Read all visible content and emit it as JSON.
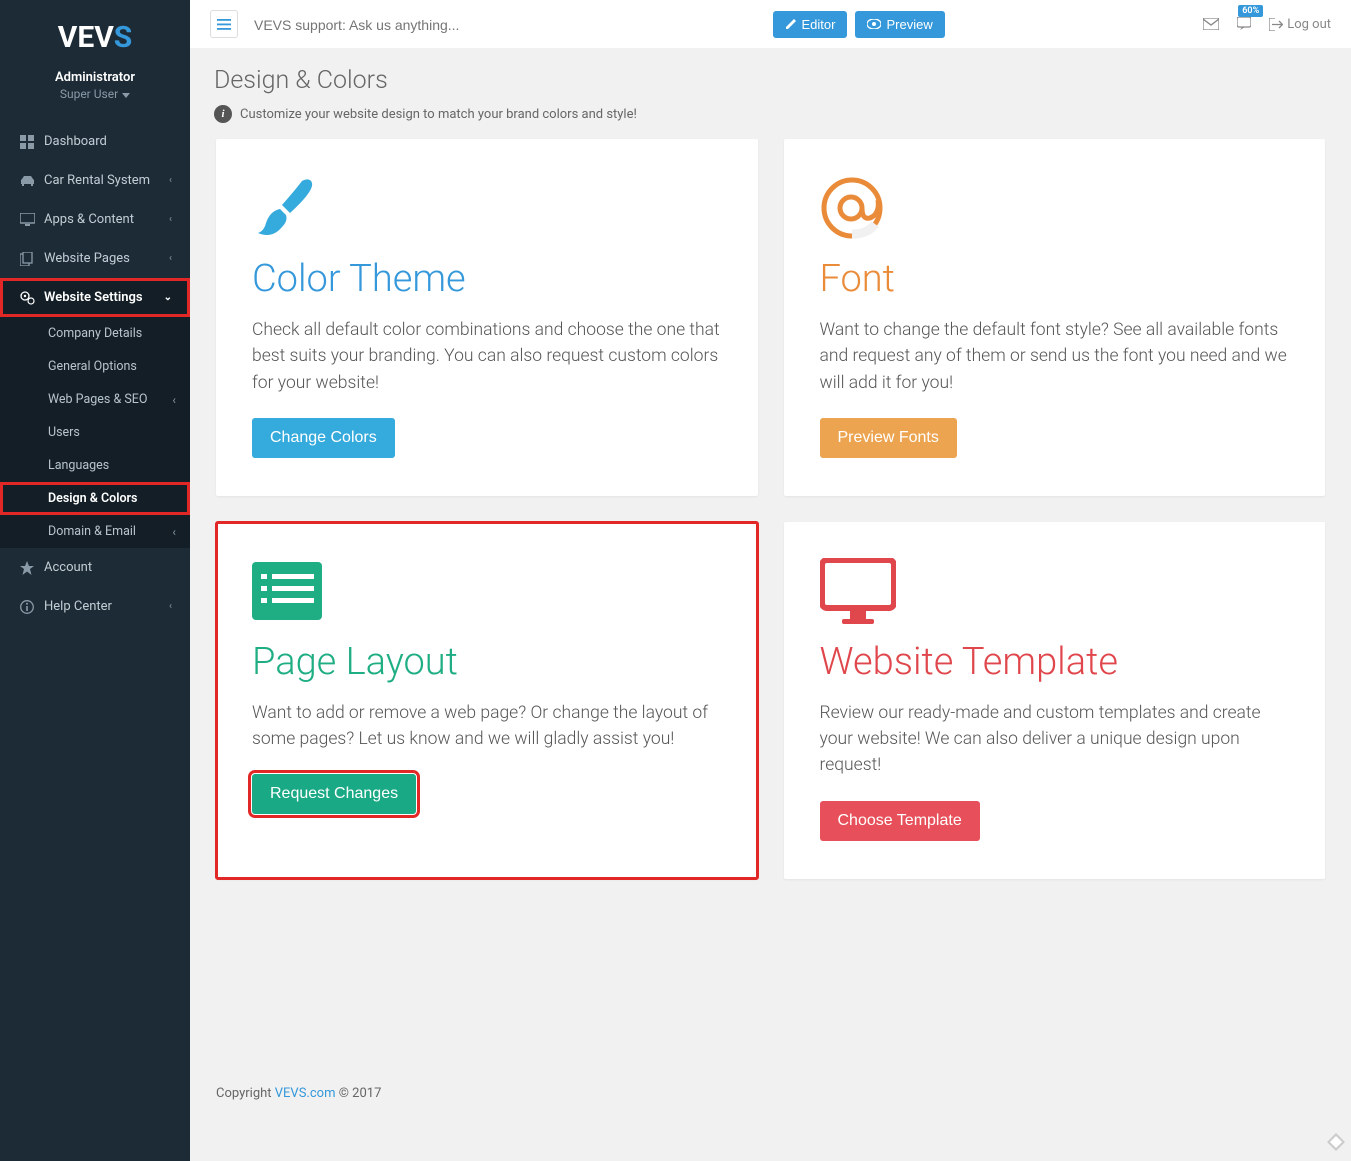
{
  "brand": {
    "prefix": "VEV",
    "suffix": "S"
  },
  "user": {
    "role": "Administrator",
    "type": "Super User"
  },
  "nav": {
    "items": [
      {
        "label": "Dashboard",
        "icon": "grid"
      },
      {
        "label": "Car Rental System",
        "icon": "car",
        "chev": true
      },
      {
        "label": "Apps & Content",
        "icon": "screen",
        "chev": true
      },
      {
        "label": "Website Pages",
        "icon": "copy",
        "chev": true
      },
      {
        "label": "Website Settings",
        "icon": "cogs",
        "chev": true,
        "active_parent": true
      },
      {
        "label": "Account",
        "icon": "star"
      },
      {
        "label": "Help Center",
        "icon": "info",
        "chev": true
      }
    ],
    "settings_sub": [
      {
        "label": "Company Details"
      },
      {
        "label": "General Options"
      },
      {
        "label": "Web Pages & SEO",
        "chev": true
      },
      {
        "label": "Users"
      },
      {
        "label": "Languages"
      },
      {
        "label": "Design & Colors",
        "active": true
      },
      {
        "label": "Domain & Email",
        "chev": true
      }
    ]
  },
  "topbar": {
    "support_placeholder": "VEVS support: Ask us anything...",
    "editor_btn": "Editor",
    "preview_btn": "Preview",
    "badge": "60%",
    "logout": "Log out"
  },
  "page": {
    "title": "Design & Colors",
    "subtitle": "Customize your website design to match your brand colors and style!"
  },
  "cards": {
    "color_theme": {
      "title": "Color Theme",
      "desc": "Check all default color combinations and choose the one that best suits your branding. You can also request custom colors for your website!",
      "btn": "Change Colors"
    },
    "font": {
      "title": "Font",
      "desc": "Want to change the default font style? See all available fonts and request any of them or send us the font you need and we will add it for you!",
      "btn": "Preview Fonts"
    },
    "page_layout": {
      "title": "Page Layout",
      "desc": "Want to add or remove a web page? Or change the layout of some pages? Let us know and we will gladly assist you!",
      "btn": "Request Changes"
    },
    "website_template": {
      "title": "Website Template",
      "desc": "Review our ready-made and custom templates and create your website! We can also deliver a unique design upon request!",
      "btn": "Choose Template"
    }
  },
  "footer": {
    "prefix": "Copyright ",
    "link": "VEVS.com",
    "suffix": " © 2017"
  }
}
